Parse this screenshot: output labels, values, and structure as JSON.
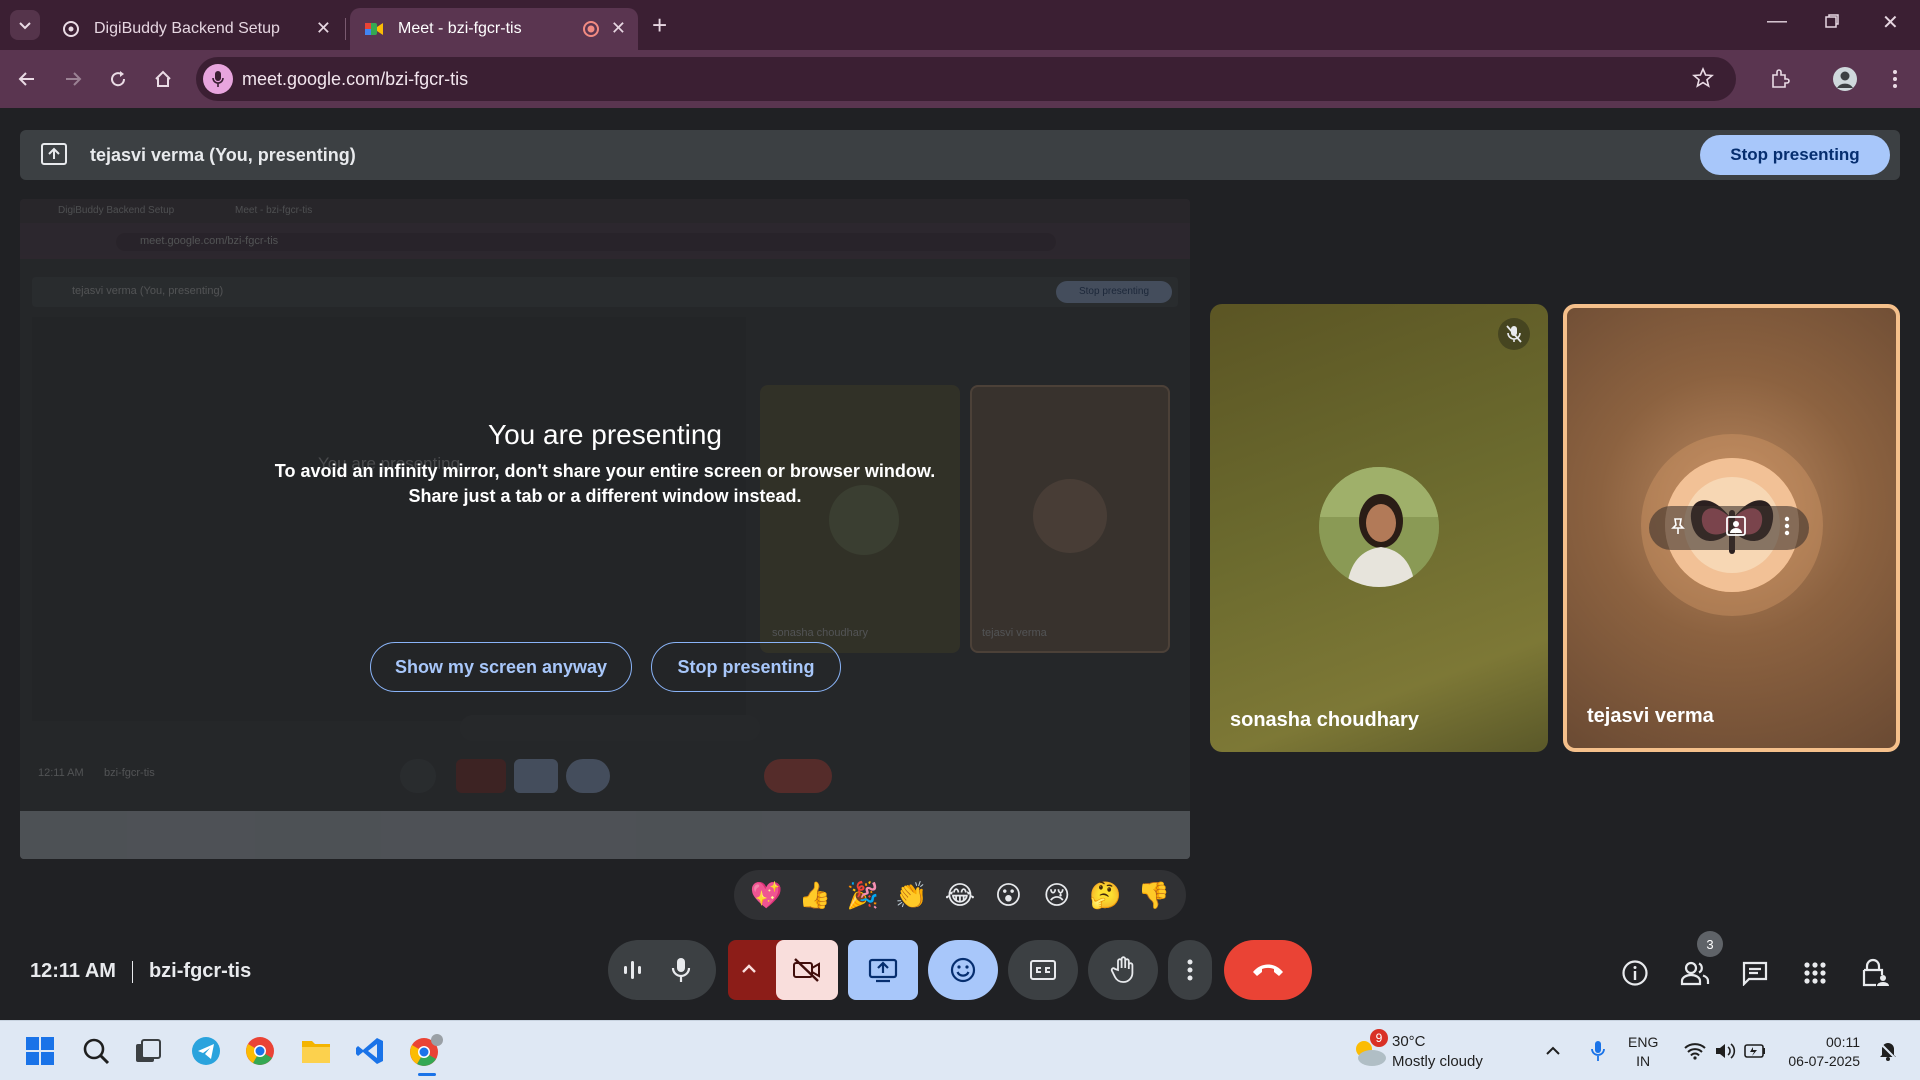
{
  "browser": {
    "tabs": [
      {
        "title": "DigiBuddy Backend Setup",
        "active": false
      },
      {
        "title": "Meet - bzi-fgcr-tis",
        "active": true
      }
    ],
    "url": "meet.google.com/bzi-fgcr-tis"
  },
  "presenting_bar": {
    "label": "tejasvi verma (You, presenting)",
    "stop_label": "Stop presenting"
  },
  "overlay": {
    "title": "You are presenting",
    "message_line1": "To avoid an infinity mirror, don't share your entire screen or browser window.",
    "message_line2": "Share just a tab or a different window instead.",
    "show_anyway_label": "Show my screen anyway",
    "stop_label": "Stop presenting"
  },
  "participants": [
    {
      "name": "sonasha choudhary",
      "muted": true
    },
    {
      "name": "tejasvi verma",
      "muted": false,
      "active_speaker": true
    }
  ],
  "reactions": [
    "💖",
    "👍",
    "🎉",
    "👏",
    "😂",
    "😮",
    "😢",
    "🤔",
    "👎"
  ],
  "meeting": {
    "time": "12:11 AM",
    "code": "bzi-fgcr-tis",
    "people_count": "3"
  },
  "mirror": {
    "tab1": "DigiBuddy Backend Setup",
    "tab2": "Meet - bzi-fgcr-tis",
    "url": "meet.google.com/bzi-fgcr-tis",
    "present_label": "tejasvi verma (You, presenting)",
    "stop_label": "Stop presenting",
    "title": "You are presenting",
    "name1": "sonasha choudhary",
    "name2": "tejasvi verma",
    "time": "12:11 AM",
    "code": "bzi-fgcr-tis"
  },
  "taskbar": {
    "weather_badge": "9",
    "weather_temp": "30°C",
    "weather_condition": "Mostly cloudy",
    "lang_line1": "ENG",
    "lang_line2": "IN",
    "clock_time": "00:11",
    "clock_date": "06-07-2025"
  },
  "colors": {
    "accent_blue": "#a8c7fa",
    "end_call_red": "#ea4335",
    "camera_off_red": "#8c1d18",
    "speaker_border": "#f5c08b"
  }
}
